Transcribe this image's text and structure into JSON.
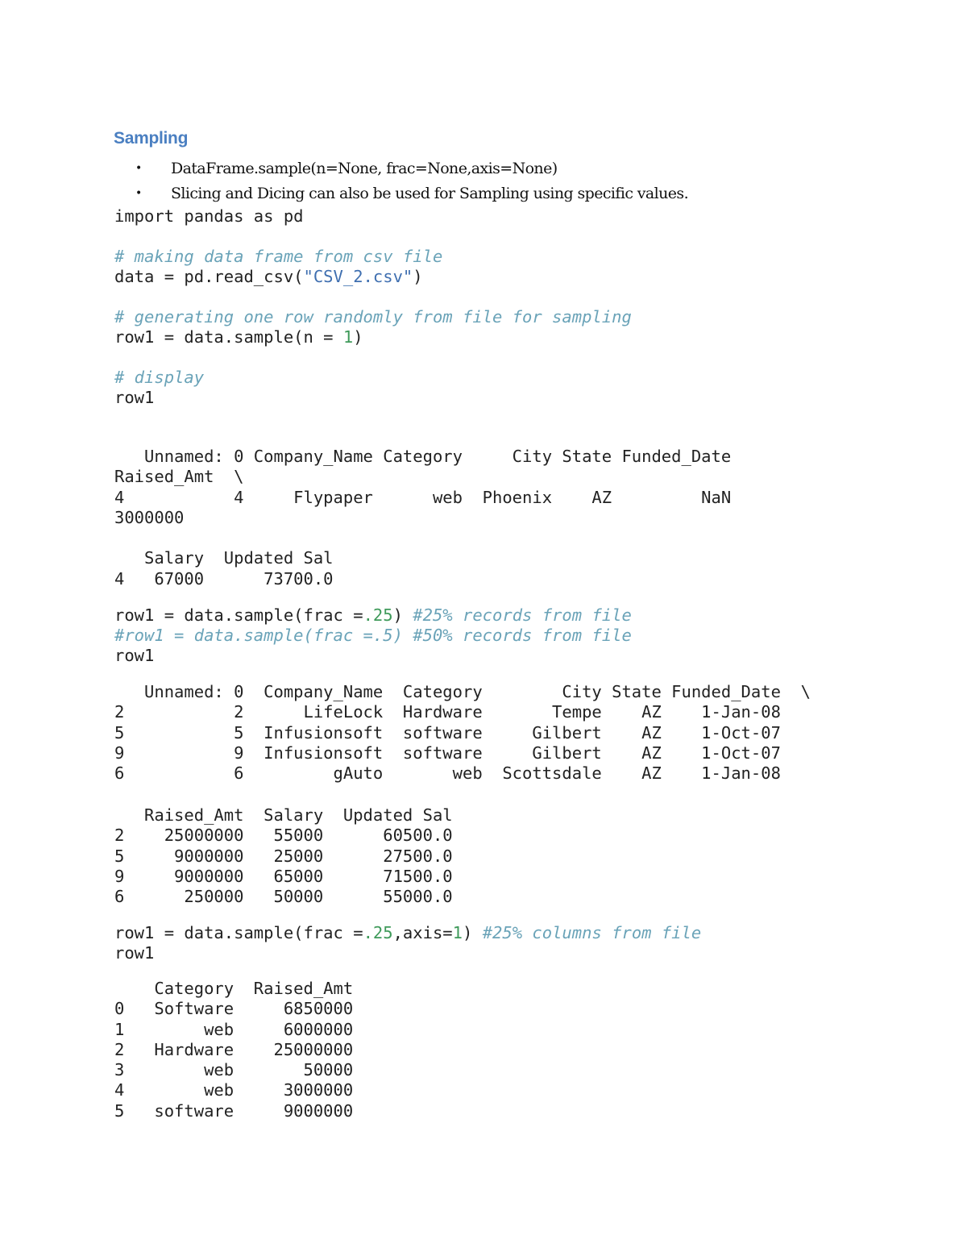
{
  "heading": "Sampling",
  "bullets": [
    "DataFrame.sample(n=None, frac=None,axis=None)",
    "Slicing and Dicing can also be used for Sampling using specific values."
  ],
  "code1": {
    "import_line": "import pandas as pd",
    "comment1": "# making data frame from csv file",
    "read_prefix": "data = pd.read_csv(",
    "read_string": "\"CSV_2.csv\"",
    "read_suffix": ")",
    "comment2": "# generating one row randomly from file for sampling",
    "sample_prefix": "row1 = data.sample(n = ",
    "sample_num": "1",
    "sample_suffix": ")",
    "comment3": "# display",
    "display": "row1"
  },
  "output1": {
    "header_line1": "   Unnamed: 0 Company_Name Category     City State Funded_Date",
    "header_line2": "Raised_Amt  \\",
    "row_line1": "4           4     Flypaper      web  Phoenix    AZ         NaN",
    "row_line2": "3000000",
    "header2": "   Salary  Updated Sal",
    "row2": "4   67000      73700.0"
  },
  "code2": {
    "line1_prefix": "row1 = data.sample(frac =",
    "line1_num": ".25",
    "line1_suffix": ") ",
    "line1_comment": "#25% records from file",
    "line2_comment": "#row1 = data.sample(frac =.5) #50% records from file",
    "line3": "row1"
  },
  "output2": {
    "columns_a": [
      "Unnamed: 0",
      "Company_Name",
      "Category",
      "City",
      "State",
      "Funded_Date"
    ],
    "rows_a": [
      {
        "index": "2",
        "Unnamed: 0": "2",
        "Company_Name": "LifeLock",
        "Category": "Hardware",
        "City": "Tempe",
        "State": "AZ",
        "Funded_Date": "1-Jan-08"
      },
      {
        "index": "5",
        "Unnamed: 0": "5",
        "Company_Name": "Infusionsoft",
        "Category": "software",
        "City": "Gilbert",
        "State": "AZ",
        "Funded_Date": "1-Oct-07"
      },
      {
        "index": "9",
        "Unnamed: 0": "9",
        "Company_Name": "Infusionsoft",
        "Category": "software",
        "City": "Gilbert",
        "State": "AZ",
        "Funded_Date": "1-Oct-07"
      },
      {
        "index": "6",
        "Unnamed: 0": "6",
        "Company_Name": "gAuto",
        "Category": "web",
        "City": "Scottsdale",
        "State": "AZ",
        "Funded_Date": "1-Jan-08"
      }
    ],
    "columns_b": [
      "Raised_Amt",
      "Salary",
      "Updated Sal"
    ],
    "rows_b": [
      {
        "index": "2",
        "Raised_Amt": "25000000",
        "Salary": "55000",
        "Updated Sal": "60500.0"
      },
      {
        "index": "5",
        "Raised_Amt": "9000000",
        "Salary": "25000",
        "Updated Sal": "27500.0"
      },
      {
        "index": "9",
        "Raised_Amt": "9000000",
        "Salary": "65000",
        "Updated Sal": "71500.0"
      },
      {
        "index": "6",
        "Raised_Amt": "250000",
        "Salary": "50000",
        "Updated Sal": "55000.0"
      }
    ],
    "continuation": "\\"
  },
  "code3": {
    "line1_prefix": "row1 = data.sample(frac =",
    "line1_num1": ".25",
    "line1_mid": ",axis=",
    "line1_num2": "1",
    "line1_suffix": ") ",
    "line1_comment": "#25% columns from file",
    "line2": "row1"
  },
  "output3": {
    "columns": [
      "Category",
      "Raised_Amt"
    ],
    "rows": [
      {
        "index": "0",
        "Category": "Software",
        "Raised_Amt": "6850000"
      },
      {
        "index": "1",
        "Category": "web",
        "Raised_Amt": "6000000"
      },
      {
        "index": "2",
        "Category": "Hardware",
        "Raised_Amt": "25000000"
      },
      {
        "index": "3",
        "Category": "web",
        "Raised_Amt": "50000"
      },
      {
        "index": "4",
        "Category": "web",
        "Raised_Amt": "3000000"
      },
      {
        "index": "5",
        "Category": "software",
        "Raised_Amt": "9000000"
      }
    ]
  }
}
